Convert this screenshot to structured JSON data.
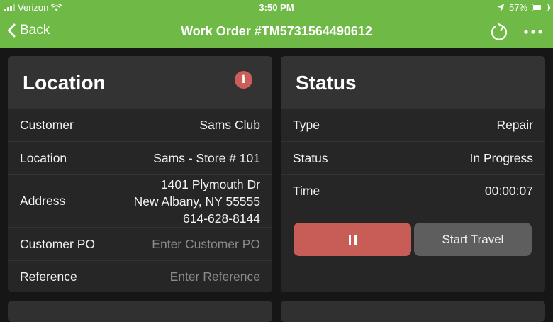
{
  "statusbar": {
    "carrier": "Verizon",
    "time": "3:50 PM",
    "battery": "57%",
    "battery_level": 0.57
  },
  "navbar": {
    "back_label": "Back",
    "title": "Work Order #TM5731564490612",
    "refresh_icon": "refresh-icon",
    "more_icon": "more-icon"
  },
  "location": {
    "title": "Location",
    "info_glyph": "i",
    "rows": {
      "customer": {
        "label": "Customer",
        "value": "Sams Club"
      },
      "location": {
        "label": "Location",
        "value": "Sams - Store # 101"
      },
      "address": {
        "label": "Address",
        "line1": "1401 Plymouth Dr",
        "line2": "New Albany, NY 55555",
        "line3": "614-628-8144"
      },
      "customer_po": {
        "label": "Customer PO",
        "placeholder": "Enter Customer PO"
      },
      "reference": {
        "label": "Reference",
        "placeholder": "Enter Reference"
      }
    }
  },
  "status": {
    "title": "Status",
    "rows": {
      "type": {
        "label": "Type",
        "value": "Repair"
      },
      "status": {
        "label": "Status",
        "value": "In Progress"
      },
      "time": {
        "label": "Time",
        "value": "00:00:07"
      }
    },
    "buttons": {
      "start_travel": "Start Travel"
    }
  },
  "colors": {
    "nav_green": "#6fba46",
    "pause_red": "#c85c57",
    "info_red": "#cb5e58"
  }
}
